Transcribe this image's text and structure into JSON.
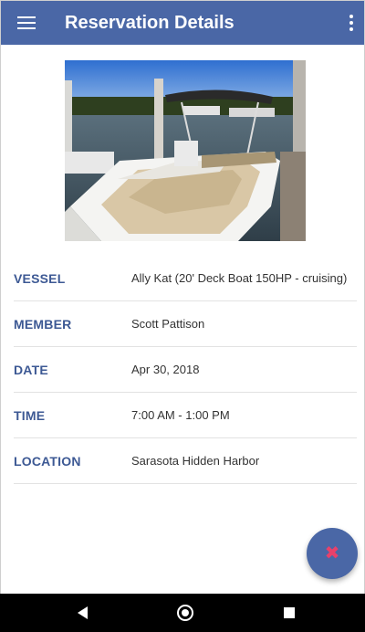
{
  "app_bar": {
    "title": "Reservation Details",
    "menu_icon": "hamburger-menu-icon",
    "overflow_icon": "more-vertical-icon",
    "color": "#4a67a6"
  },
  "photo": {
    "subject": "deck boat docked at marina"
  },
  "details": [
    {
      "label": "VESSEL",
      "value": "Ally Kat (20' Deck Boat 150HP - cruising)"
    },
    {
      "label": "MEMBER",
      "value": "Scott Pattison"
    },
    {
      "label": "DATE",
      "value": "Apr 30, 2018"
    },
    {
      "label": "TIME",
      "value": "7:00 AM - 1:00 PM"
    },
    {
      "label": "LOCATION",
      "value": "Sarasota Hidden Harbor"
    }
  ],
  "fab": {
    "icon": "close-icon",
    "color": "#4a67a6",
    "icon_color": "#e8416b"
  },
  "navigation": {
    "back_icon": "back-triangle-icon",
    "home_icon": "home-circle-icon",
    "recents_icon": "recents-square-icon"
  }
}
